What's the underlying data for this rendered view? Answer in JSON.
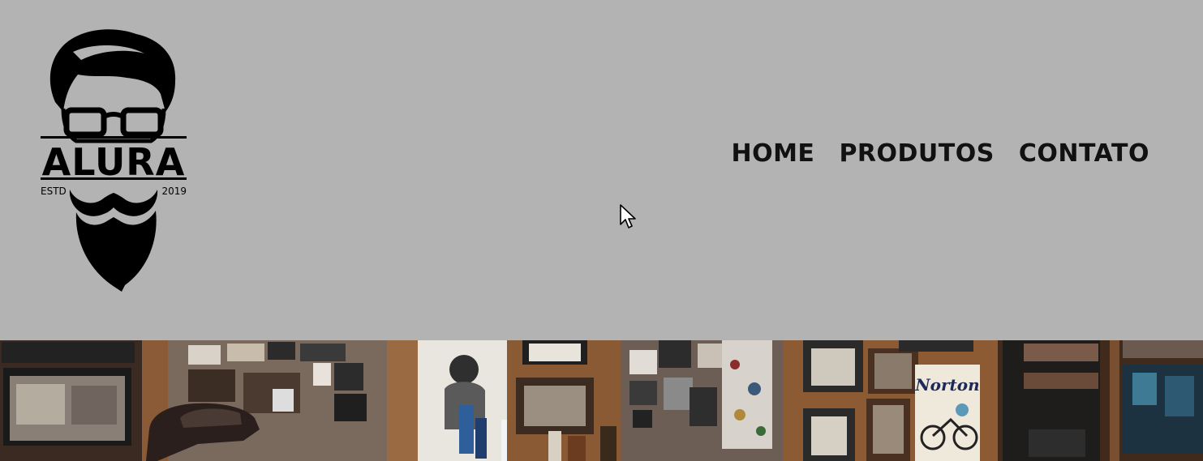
{
  "brand": {
    "name": "ALURA",
    "estd_label": "ESTD",
    "year": "2019"
  },
  "nav": {
    "items": [
      {
        "label": "HOME"
      },
      {
        "label": "PRODUTOS"
      },
      {
        "label": "CONTATO"
      }
    ]
  },
  "hero": {
    "photo": "barbershop-interior-photo",
    "poster_text": "Norton"
  },
  "colors": {
    "header_bg": "#b3b3b3",
    "text": "#111111",
    "logo": "#000000"
  }
}
